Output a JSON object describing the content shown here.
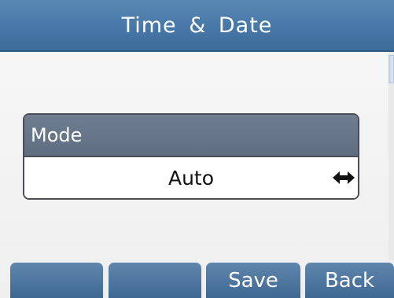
{
  "header": {
    "title": "Time & Date"
  },
  "field": {
    "label": "Mode",
    "value": "Auto",
    "toggle_icon": "left-right-arrow-icon"
  },
  "softkeys": [
    "",
    "",
    "Save",
    "Back"
  ],
  "colors": {
    "title_bar": "#4576a5",
    "field_label_bg": "#65768a",
    "softkey_bg": "#4f79a2"
  }
}
